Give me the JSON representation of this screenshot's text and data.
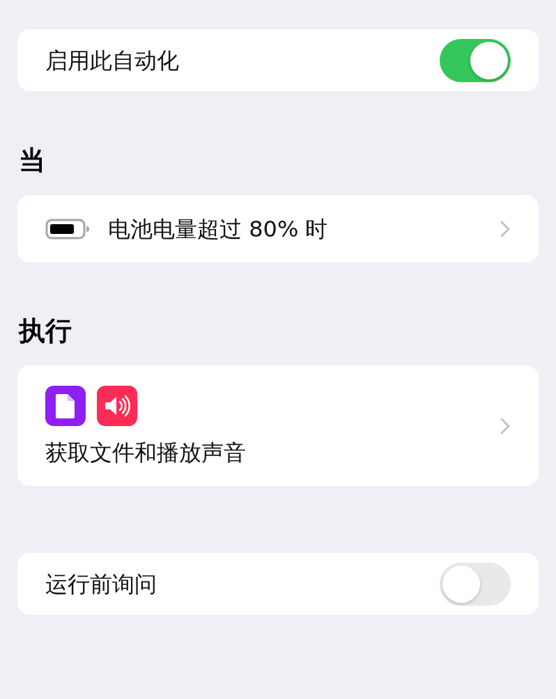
{
  "automation_toggle": {
    "label": "启用此自动化",
    "on": true
  },
  "trigger_section": {
    "header": "当",
    "items": [
      {
        "label": "电池电量超过 80% 时"
      }
    ]
  },
  "action_section": {
    "header": "执行",
    "summary": "获取文件和播放声音"
  },
  "ask_toggle": {
    "label": "运行前询问",
    "on": false
  }
}
